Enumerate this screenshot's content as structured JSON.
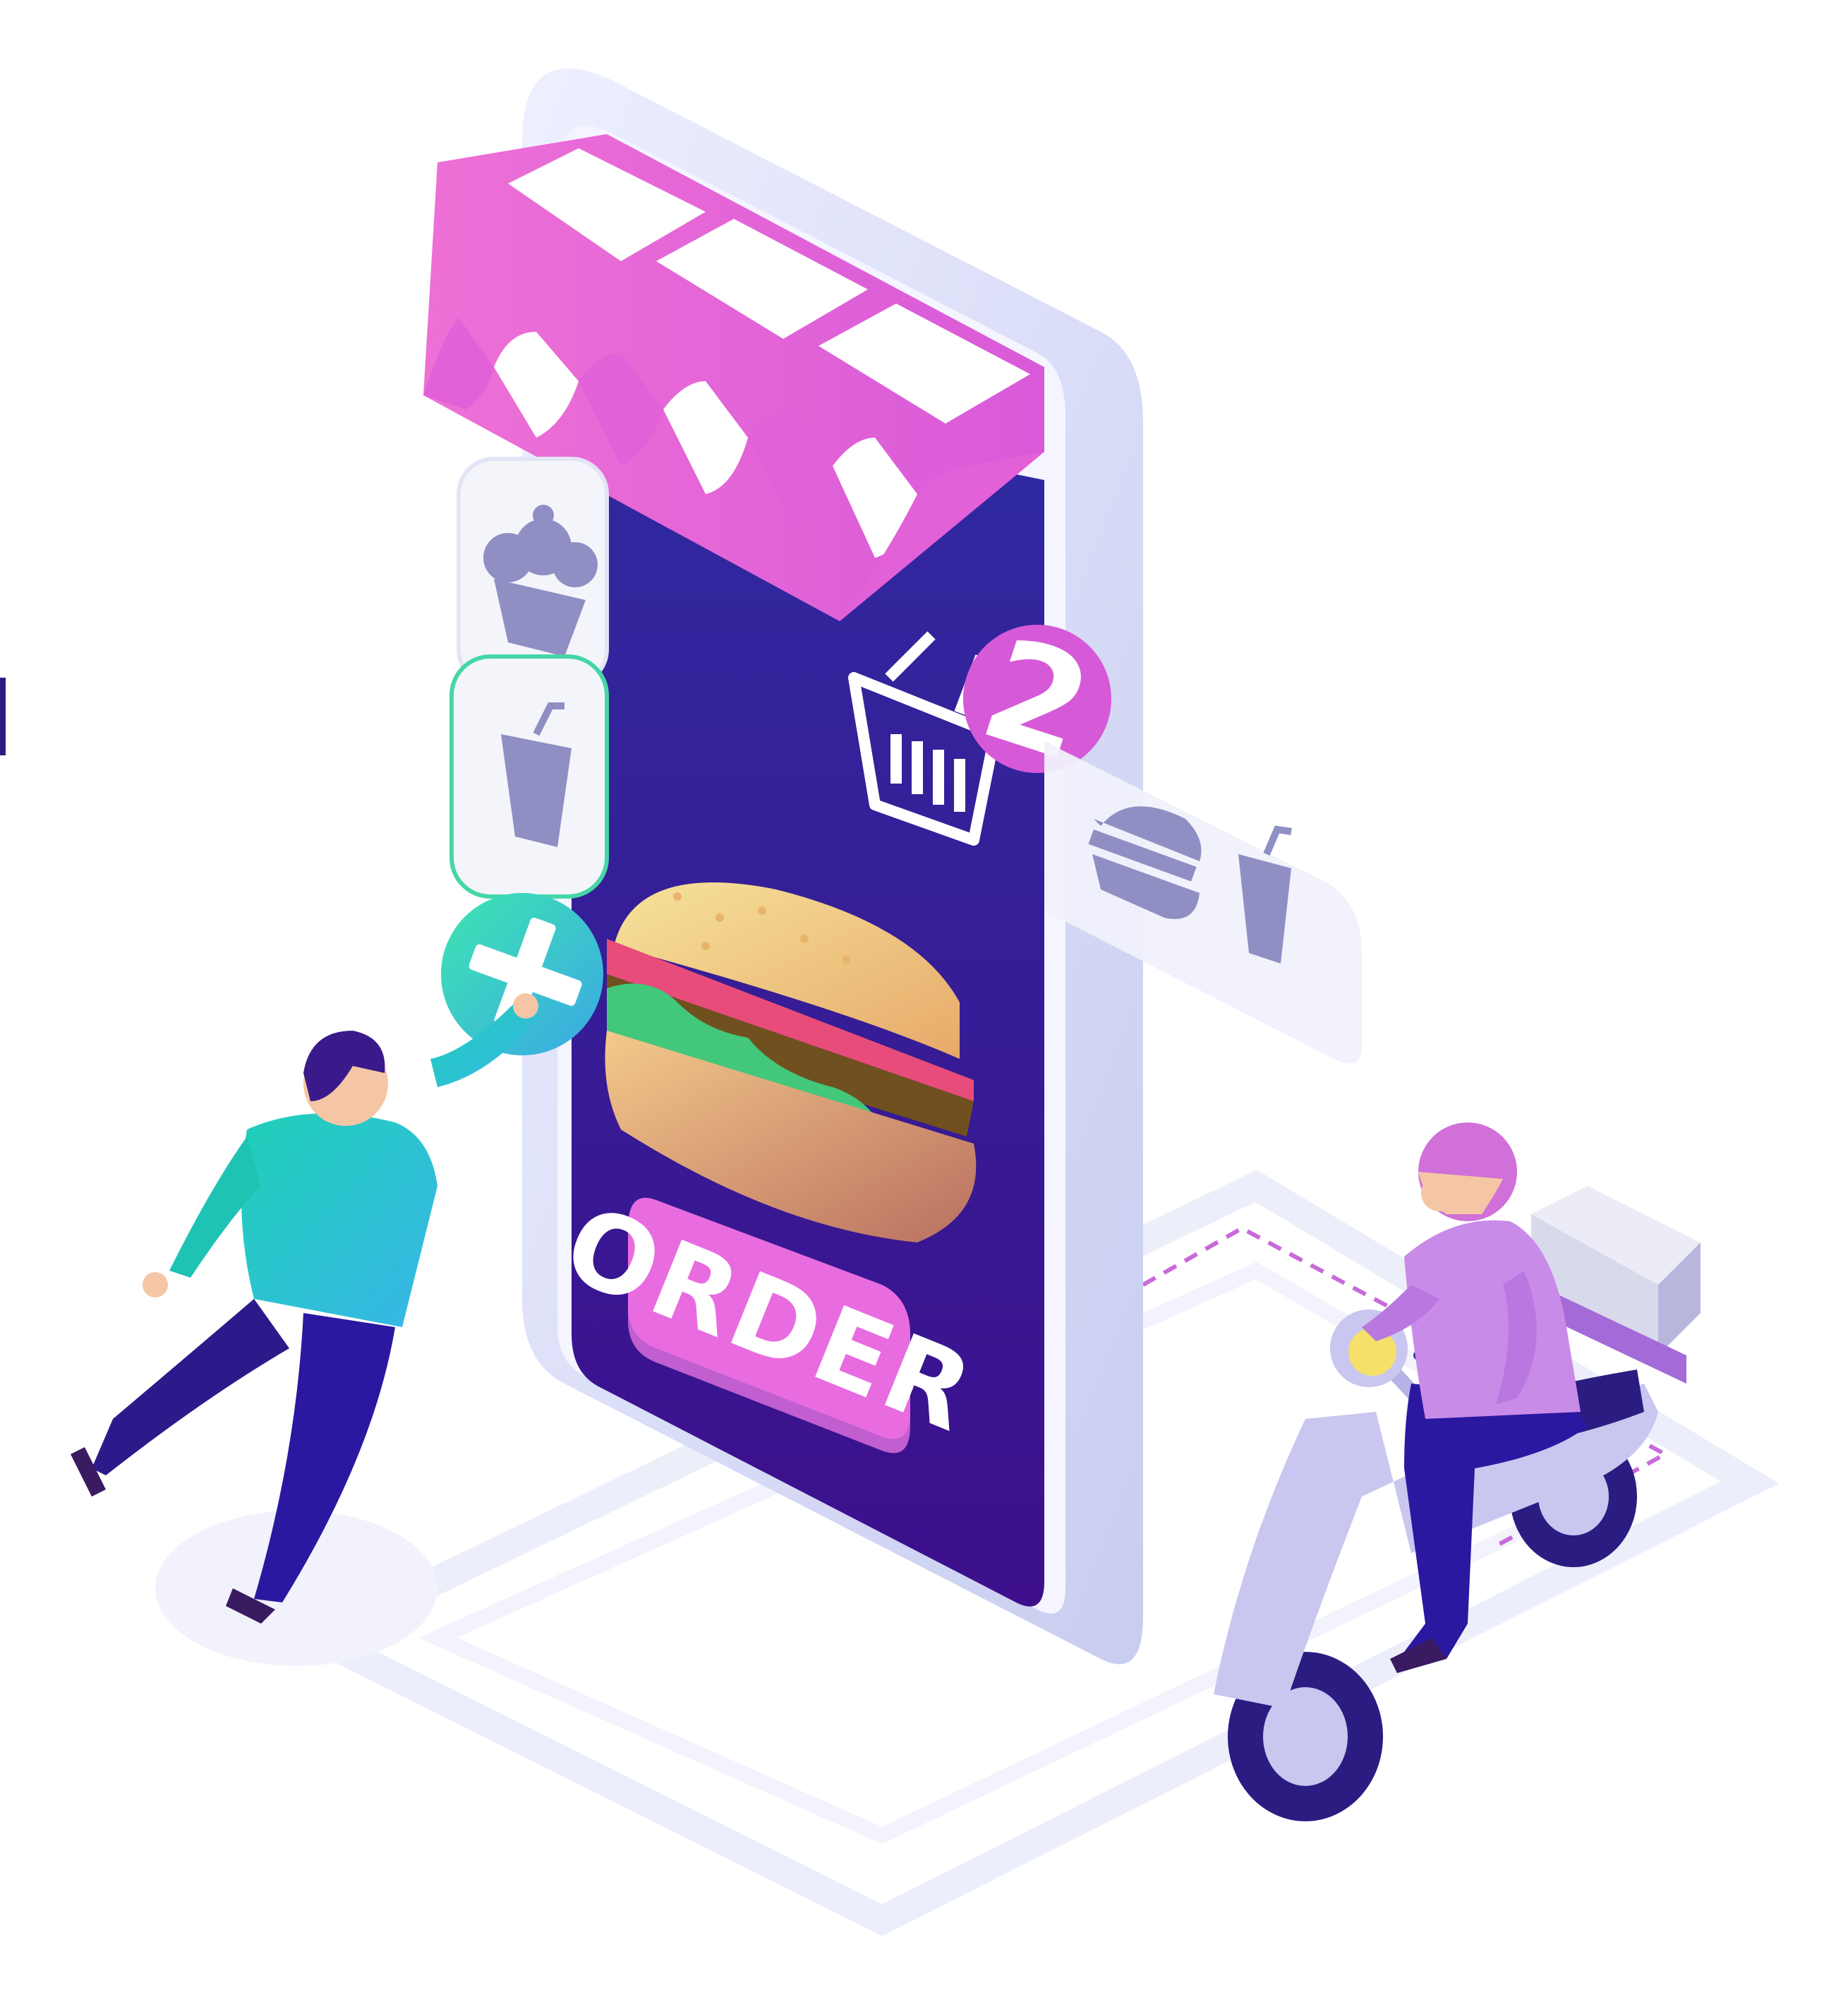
{
  "illustration": {
    "button_label": "ORDER",
    "cart_badge_count": "2",
    "icons": [
      "cupcake-icon",
      "cup-icon",
      "plus-icon",
      "basket-icon",
      "burger-icon",
      "cup-icon"
    ]
  },
  "colors": {
    "screen": "#3a1ea0",
    "awning_pink": "#ee6fd4",
    "awning_white": "#ffffff",
    "button": "#e06ce0",
    "badge": "#d65ad8",
    "plus_button": "#35d6c0",
    "phone_frame": "#d8dbf5",
    "customer_shirt": "#2ec7c4",
    "courier_shirt": "#c98be8",
    "scooter": "#c9c6f0"
  }
}
